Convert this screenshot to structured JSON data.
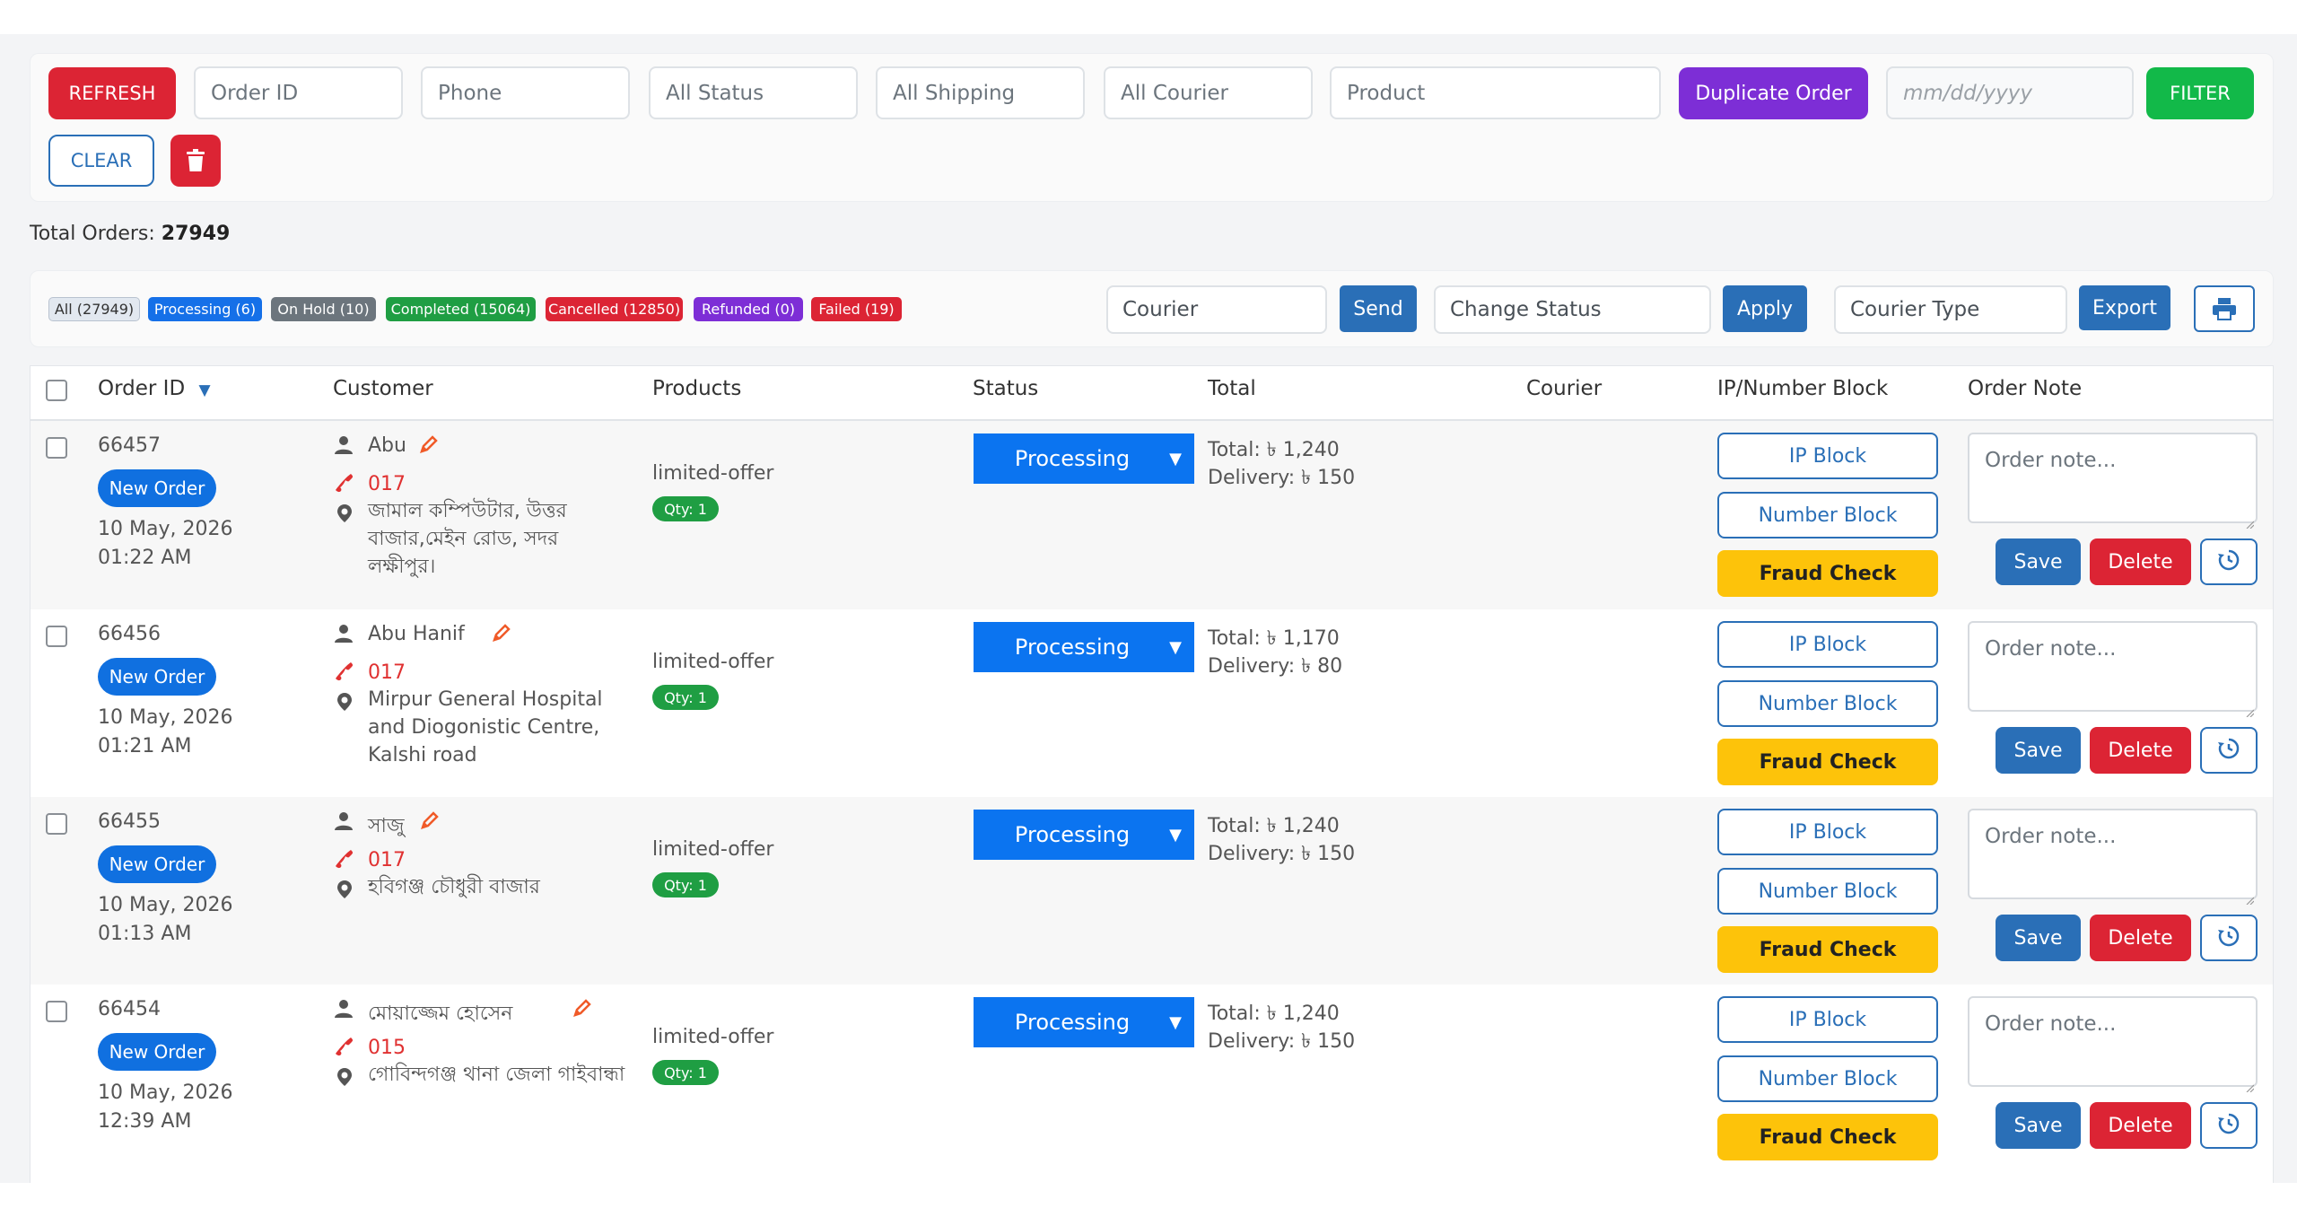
{
  "filters": {
    "refresh_label": "REFRESH",
    "order_id_placeholder": "Order ID",
    "phone_placeholder": "Phone",
    "status_value": "All Status",
    "shipping_value": "All Shipping",
    "courier_value": "All Courier",
    "product_placeholder": "Product",
    "duplicate_label": "Duplicate Order",
    "date_placeholder": "mm/dd/yyyy",
    "filter_label": "FILTER",
    "clear_label": "CLEAR",
    "delete_icon": "trash-icon"
  },
  "summary": {
    "label": "Total Orders:",
    "count": "27949"
  },
  "status_pills": [
    {
      "label": "All (27949)",
      "color": "#e2e8f0"
    },
    {
      "label": "Processing (6)",
      "color": "#1570e8"
    },
    {
      "label": "On Hold (10)",
      "color": "#6c757d"
    },
    {
      "label": "Completed (15064)",
      "color": "#1f9e43"
    },
    {
      "label": "Cancelled (12850)",
      "color": "#dc2434"
    },
    {
      "label": "Refunded (0)",
      "color": "#7d2ed6"
    },
    {
      "label": "Failed (19)",
      "color": "#dc2434"
    }
  ],
  "actions": {
    "courier_placeholder": "Courier",
    "send_label": "Send",
    "change_status_placeholder": "Change Status",
    "apply_label": "Apply",
    "courier_type_placeholder": "Courier Type",
    "export_label": "Export",
    "print_icon": "print-icon"
  },
  "table": {
    "headers": {
      "order_id": "Order ID",
      "sort_indicator": "▼",
      "customer": "Customer",
      "products": "Products",
      "status": "Status",
      "total": "Total",
      "courier": "Courier",
      "ip_block": "IP/Number Block",
      "order_note": "Order Note"
    },
    "rows": [
      {
        "id": "66457",
        "badge": "New Order",
        "date": "10 May, 2026",
        "time": "01:22 AM",
        "customer": "Abu",
        "phone": "017",
        "address": "জামাল কম্পিউটার, উত্তর বাজার,মেইন রোড, সদর লক্ষীপুর।",
        "product": "limited-offer",
        "qty": "Qty: 1",
        "status": "Processing",
        "total": "Total: ৳ 1,240",
        "delivery": "Delivery: ৳ 150",
        "ip_block": "IP Block",
        "number_block": "Number Block",
        "fraud_check": "Fraud Check",
        "note_placeholder": "Order note...",
        "save": "Save",
        "delete": "Delete"
      },
      {
        "id": "66456",
        "badge": "New Order",
        "date": "10 May, 2026",
        "time": "01:21 AM",
        "customer": "Abu Hanif",
        "phone": "017",
        "address": "Mirpur General Hospital and Diogonistic Centre, Kalshi road",
        "product": "limited-offer",
        "qty": "Qty: 1",
        "status": "Processing",
        "total": "Total: ৳ 1,170",
        "delivery": "Delivery: ৳ 80",
        "ip_block": "IP Block",
        "number_block": "Number Block",
        "fraud_check": "Fraud Check",
        "note_placeholder": "Order note...",
        "save": "Save",
        "delete": "Delete"
      },
      {
        "id": "66455",
        "badge": "New Order",
        "date": "10 May, 2026",
        "time": "01:13 AM",
        "customer": "সাজু",
        "phone": "017",
        "address": "হবিগঞ্জ চৌধুরী বাজার",
        "product": "limited-offer",
        "qty": "Qty: 1",
        "status": "Processing",
        "total": "Total: ৳ 1,240",
        "delivery": "Delivery: ৳ 150",
        "ip_block": "IP Block",
        "number_block": "Number Block",
        "fraud_check": "Fraud Check",
        "note_placeholder": "Order note...",
        "save": "Save",
        "delete": "Delete"
      },
      {
        "id": "66454",
        "badge": "New Order",
        "date": "10 May, 2026",
        "time": "12:39 AM",
        "customer": "মোয়াজ্জেম হোসেন",
        "phone": "015",
        "address": "গোবিন্দগঞ্জ থানা জেলা গাইবান্ধা",
        "product": "limited-offer",
        "qty": "Qty: 1",
        "status": "Processing",
        "total": "Total: ৳ 1,240",
        "delivery": "Delivery: ৳ 150",
        "ip_block": "IP Block",
        "number_block": "Number Block",
        "fraud_check": "Fraud Check",
        "note_placeholder": "Order note...",
        "save": "Save",
        "delete": "Delete"
      }
    ]
  },
  "colors": {
    "primary": "#2a6fb7",
    "danger": "#dc2434",
    "success": "#12b949",
    "purple": "#7d2ed6",
    "status_blue": "#0b74f0",
    "warning": "#fdc30a"
  },
  "icons": [
    "trash-icon",
    "print-icon",
    "user-icon",
    "edit-pencil-icon",
    "phone-icon",
    "location-pin-icon",
    "history-icon",
    "resize-handle-icon"
  ]
}
